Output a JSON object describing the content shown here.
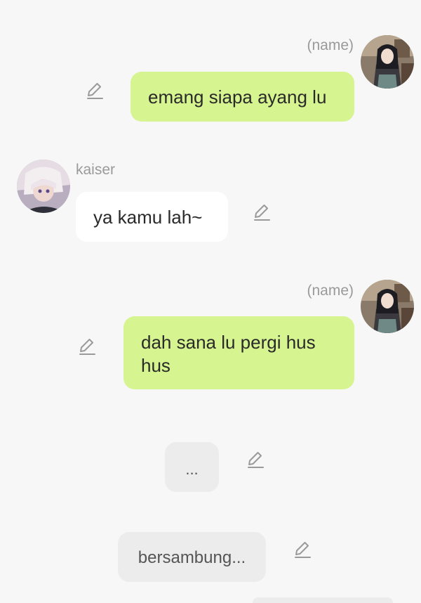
{
  "messages": [
    {
      "sender": "(name)",
      "text": "emang siapa ayang lu",
      "side": "right",
      "avatar_icon": "user-avatar-dark-hair"
    },
    {
      "sender": "kaiser",
      "text": "ya kamu lah~",
      "side": "left",
      "avatar_icon": "character-avatar-white-hair"
    },
    {
      "sender": "(name)",
      "text": "dah sana lu pergi hus hus",
      "side": "right",
      "avatar_icon": "user-avatar-dark-hair"
    },
    {
      "text": "..."
    },
    {
      "text": "bersambung..."
    }
  ],
  "icons": {
    "edit": "pencil-icon"
  },
  "colors": {
    "background": "#f7f7f7",
    "user_bubble": "#d6f48f",
    "other_bubble": "#ffffff",
    "narration_bubble": "#ececec",
    "name_text": "#9a9a9a",
    "pencil": "#9a9a9a"
  }
}
